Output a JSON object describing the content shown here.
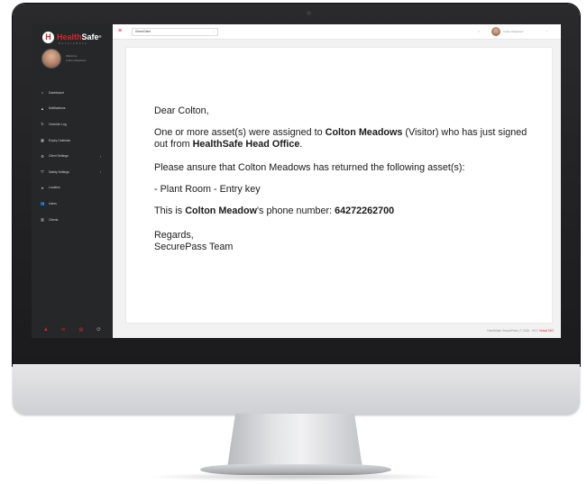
{
  "brand": {
    "logo_icon": "H",
    "name_red": "Health",
    "name_white": "Safe",
    "registered": "®",
    "subtitle": "SecurePass",
    "accent_color": "#e0222b"
  },
  "sidebar": {
    "welcome": "Welcome,",
    "user_name": "Colton Meadows",
    "items": [
      {
        "label": "Dashboard",
        "icon": "home-icon",
        "glyph": "⌂",
        "chevron": ""
      },
      {
        "label": "Notifications",
        "icon": "bell-icon",
        "glyph": "▲",
        "chevron": ""
      },
      {
        "label": "Override Log",
        "icon": "refresh-icon",
        "glyph": "↻",
        "chevron": ""
      },
      {
        "label": "Expiry Calendar",
        "icon": "calendar-icon",
        "glyph": "▦",
        "chevron": ""
      },
      {
        "label": "Client Settings",
        "icon": "gear-icon",
        "glyph": "⚙",
        "chevron": "›"
      },
      {
        "label": "Safety Settings",
        "icon": "shield-icon",
        "glyph": "⛉",
        "chevron": "›"
      },
      {
        "label": "Location",
        "icon": "location-arrow-icon",
        "glyph": "➤",
        "chevron": ""
      },
      {
        "label": "Users",
        "icon": "users-icon",
        "glyph": "👥",
        "chevron": ""
      },
      {
        "label": "Clients",
        "icon": "building-icon",
        "glyph": "▥",
        "chevron": ""
      }
    ],
    "footer_icons": [
      {
        "name": "user-icon",
        "glyph": "♟"
      },
      {
        "name": "chat-icon",
        "glyph": "✉"
      },
      {
        "name": "table-icon",
        "glyph": "▤"
      },
      {
        "name": "power-icon",
        "glyph": "⏻"
      }
    ]
  },
  "topbar": {
    "menu_glyph": "≡",
    "site_select_value": "GreenClient",
    "select_caret": "⌄",
    "search_glyph": "⌕",
    "user_name": "Colton Meadows",
    "user_caret": "⌄"
  },
  "email": {
    "greeting": "Dear Colton,",
    "p1_pre": "One or more asset(s) were assigned to ",
    "p1_name": "Colton Meadows",
    "p1_mid": " (Visitor) who has just signed out from ",
    "p1_site": "HealthSafe Head Office",
    "p1_end": ".",
    "p2": "Please ansure that Colton Meadows has returned the following asset(s):",
    "p3": "- Plant Room - Entry key",
    "p4_pre": "This is ",
    "p4_name": "Colton Meadow",
    "p4_mid": "'s phone number: ",
    "p4_phone": "64272262700",
    "closing": "Regards,",
    "signature": "SecurePass Team"
  },
  "footer": {
    "copyright": "HealthSafe SecurePass | © 2016 - 2017 ",
    "link": "Virtual TAG"
  }
}
